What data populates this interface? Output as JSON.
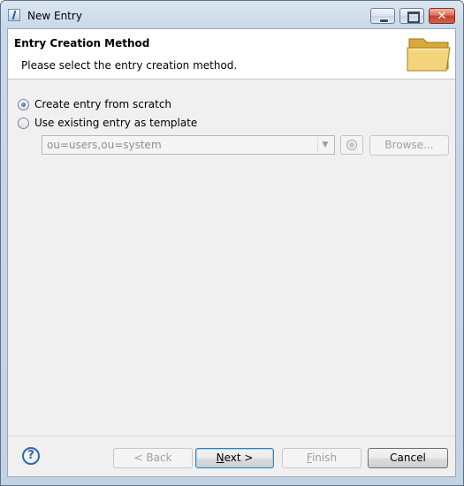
{
  "window": {
    "title": "New Entry"
  },
  "header": {
    "title": "Entry Creation Method",
    "description": "Please select the entry creation method."
  },
  "options": [
    {
      "label": "Create entry from scratch",
      "selected": true
    },
    {
      "label": "Use existing entry as template",
      "selected": false
    }
  ],
  "template": {
    "dn_value": "ou=users,ou=system",
    "browse_label": "Browse..."
  },
  "footer": {
    "back_label": "< Back",
    "next_prefix": "N",
    "next_suffix": "ext >",
    "finish_prefix": "F",
    "finish_suffix": "inish",
    "cancel_label": "Cancel"
  },
  "colors": {
    "accent": "#2d6aa7",
    "folder": "#e9c25a"
  }
}
